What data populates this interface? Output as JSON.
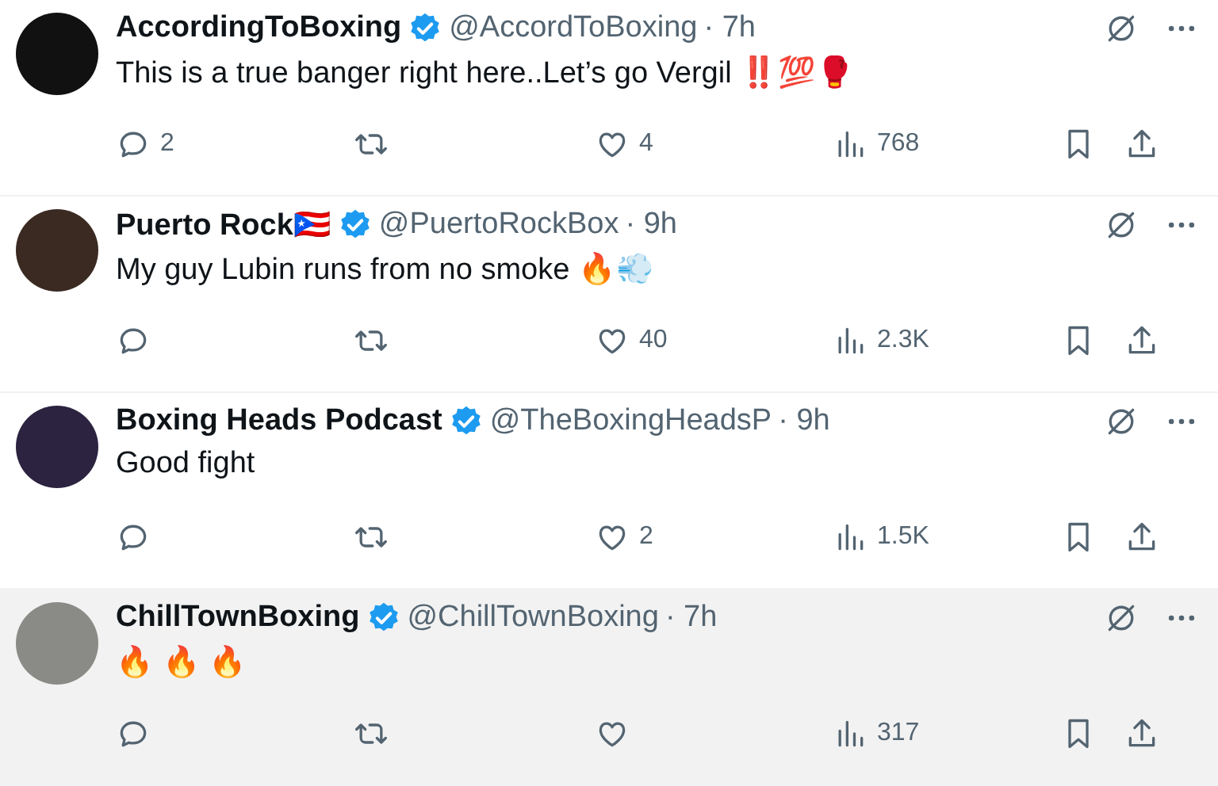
{
  "tweets": [
    {
      "name": "AccordingToBoxing",
      "verified": true,
      "handle": "@AccordToBoxing",
      "time": "· 7h",
      "text": "This is a true banger right here..Let’s go Vergil ‼️💯🥊",
      "replies": "2",
      "likes": "4",
      "views": "768",
      "highlighted": false
    },
    {
      "name": "Puerto Rock🇵🇷",
      "verified": true,
      "handle": "@PuertoRockBox",
      "time": "· 9h",
      "text": "My guy Lubin runs from no smoke 🔥💨",
      "likes": "40",
      "views": "2.3K",
      "highlighted": false
    },
    {
      "name": "Boxing Heads Podcast",
      "verified": true,
      "handle": "@TheBoxingHeadsP",
      "time": "· 9h",
      "text": "Good fight",
      "likes": "2",
      "views": "1.5K",
      "highlighted": false
    },
    {
      "name": "ChillTownBoxing",
      "verified": true,
      "handle": "@ChillTownBoxing",
      "time": "· 7h",
      "text": "🔥 🔥 🔥",
      "views": "317",
      "highlighted": true
    }
  ]
}
